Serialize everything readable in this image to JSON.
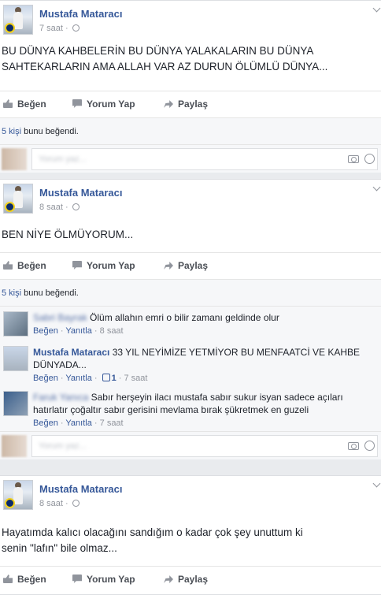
{
  "labels": {
    "like": "Beğen",
    "comment": "Yorum Yap",
    "share": "Paylaş",
    "reply": "Yanıtla",
    "dot": "·",
    "likes_suffix": "bunu beğendi.",
    "write_comment": "Yorum yaz..."
  },
  "posts": [
    {
      "author": "Mustafa Mataracı",
      "time": "7 saat",
      "text": "BU DÜNYA KAHBELERİN BU DÜNYA YALAKALARIN BU DÜNYA SAHTEKARLARIN AMA ALLAH VAR AZ DURUN ÖLÜMLÜ DÜNYA...",
      "likes_count": "5 kişi"
    },
    {
      "author": "Mustafa Mataracı",
      "time": "8 saat",
      "text": "BEN NİYE ÖLMÜYORUM...",
      "likes_count": "5 kişi",
      "comments": [
        {
          "name": "Sabri Bayrak",
          "text": "Ölüm allahın emri o bilir zamanı geldinde olur",
          "time": "8 saat",
          "likes": ""
        },
        {
          "name": "Mustafa Mataracı",
          "text": "33 YIL NEYİMİZE YETMİYOR BU MENFAATCİ VE KAHBE DÜNYADA...",
          "time": "7 saat",
          "likes": "1"
        },
        {
          "name": "Faruk Yanıca",
          "text": "Sabır herşeyin ilacı mustafa sabır sukur isyan sadece açıları hatırlatır çoğaltır sabır gerisini mevlama bırak şükretmek en guzeli",
          "time": "7 saat",
          "likes": ""
        }
      ]
    },
    {
      "author": "Mustafa Mataracı",
      "time": "8 saat",
      "text": "Hayatımda kalıcı olacağını sandığım o kadar çok şey unuttum ki senin \"lafın\" bile olmaz..."
    }
  ]
}
